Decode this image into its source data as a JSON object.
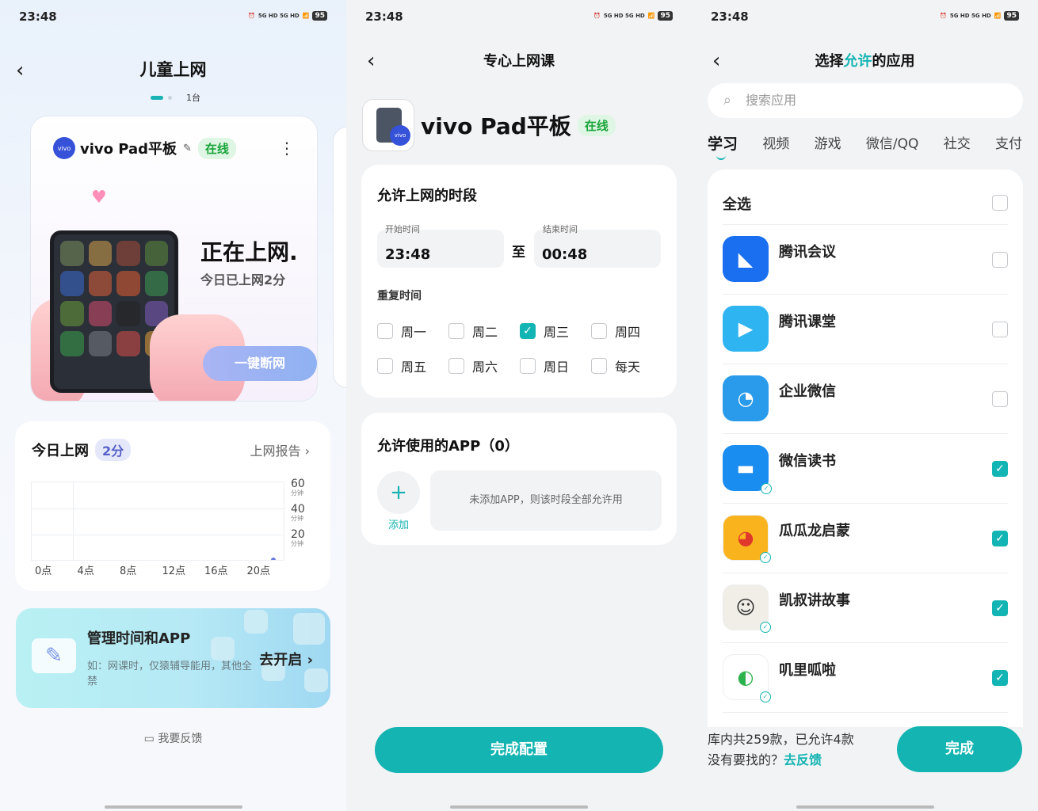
{
  "status": {
    "time": "23:48",
    "signal": "5G HD 5G HD",
    "battery": "95"
  },
  "panel1": {
    "title": "儿童上网",
    "pager_count": "1台",
    "device": {
      "name": "vivo Pad平板",
      "logo_text": "vivo",
      "status": "在线",
      "surfing": "正在上网.",
      "today_usage": "今日已上网2分",
      "cut_button": "一键断网"
    },
    "usage": {
      "title": "今日上网",
      "badge": "2分",
      "report_link": "上网报告"
    },
    "chart_data": {
      "type": "bar",
      "categories": [
        "0点",
        "4点",
        "8点",
        "12点",
        "16点",
        "20点"
      ],
      "values": [
        0,
        0,
        0,
        0,
        0,
        2
      ],
      "y_ticks": [
        {
          "value": "60",
          "unit": "分钟"
        },
        {
          "value": "40",
          "unit": "分钟"
        },
        {
          "value": "20",
          "unit": "分钟"
        }
      ],
      "ylim": [
        0,
        60
      ]
    },
    "manage": {
      "title": "管理时间和APP",
      "desc": "如：网课时，仅猿辅导能用，其他全禁",
      "go": "去开启"
    },
    "feedback": "我要反馈"
  },
  "panel2": {
    "title": "专心上网课",
    "device": {
      "name": "vivo Pad平板",
      "status": "在线",
      "logo_text": "vivo"
    },
    "period": {
      "title": "允许上网的时段",
      "start_label": "开始时间",
      "start": "23:48",
      "to": "至",
      "end_label": "结束时间",
      "end": "00:48",
      "repeat_label": "重复时间"
    },
    "days": [
      {
        "label": "周一",
        "checked": false
      },
      {
        "label": "周二",
        "checked": false
      },
      {
        "label": "周三",
        "checked": true
      },
      {
        "label": "周四",
        "checked": false
      },
      {
        "label": "周五",
        "checked": false
      },
      {
        "label": "周六",
        "checked": false
      },
      {
        "label": "周日",
        "checked": false
      },
      {
        "label": "每天",
        "checked": false
      }
    ],
    "apps": {
      "title": "允许使用的APP（0）",
      "add_label": "添加",
      "empty_hint": "未添加APP，则该时段全部允许用"
    },
    "done": "完成配置"
  },
  "panel3": {
    "title_pre": "选择",
    "title_hl": "允许",
    "title_post": "的应用",
    "search_placeholder": "搜索应用",
    "tabs": [
      "学习",
      "视频",
      "游戏",
      "微信/QQ",
      "社交",
      "支付"
    ],
    "select_all": "全选",
    "apps": [
      {
        "name": "腾讯会议",
        "checked": false,
        "color": "#1a6ff0"
      },
      {
        "name": "腾讯课堂",
        "checked": false,
        "color": "#2fb4f2"
      },
      {
        "name": "企业微信",
        "checked": false,
        "color": "#2a9bea"
      },
      {
        "name": "微信读书",
        "checked": true,
        "color": "#1a8df0"
      },
      {
        "name": "瓜瓜龙启蒙",
        "checked": true,
        "color": "#f9b41d"
      },
      {
        "name": "凯叔讲故事",
        "checked": true,
        "color": "#f1eee8"
      },
      {
        "name": "叽里呱啦",
        "checked": true,
        "color": "#ffffff"
      }
    ],
    "footer_line1": "库内共259款，已允许4款",
    "footer_line2": "没有要找的？",
    "footer_link": "去反馈",
    "done": "完成"
  }
}
